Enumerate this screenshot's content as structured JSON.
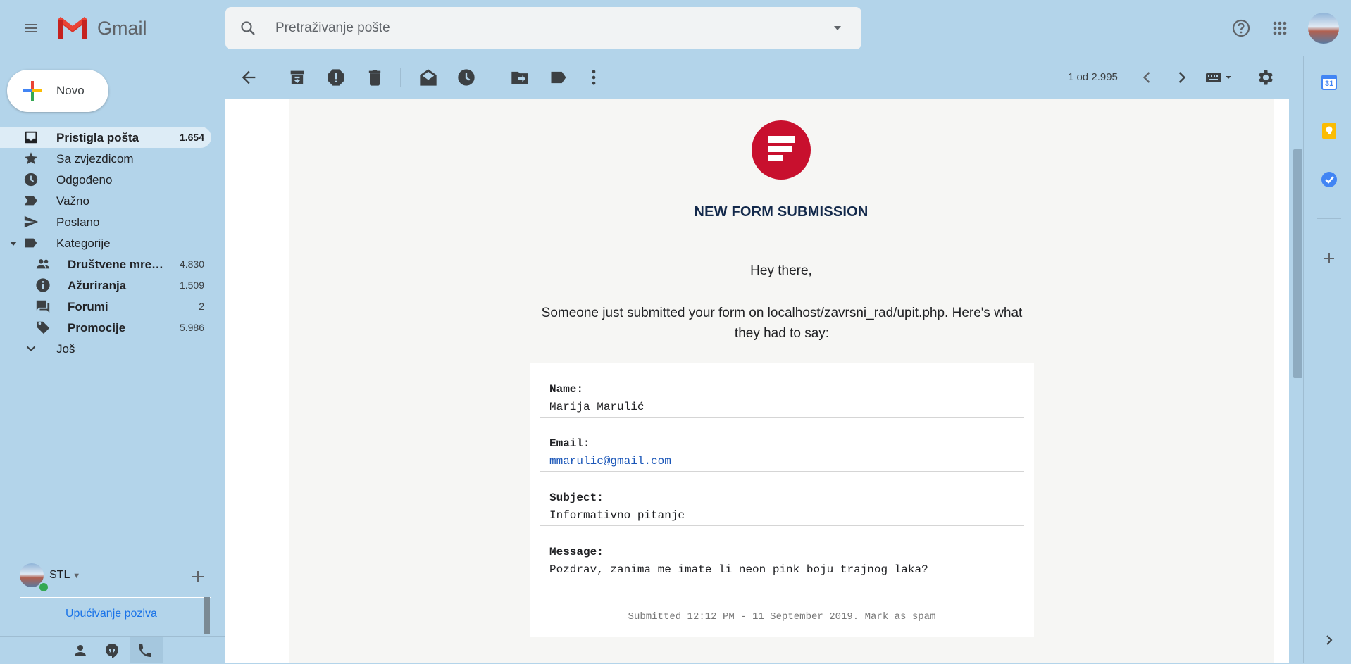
{
  "app": {
    "name": "Gmail"
  },
  "search": {
    "placeholder": "Pretraživanje pošte"
  },
  "compose": {
    "label": "Novo"
  },
  "sidebar": {
    "items": [
      {
        "label": "Pristigla pošta",
        "count": "1.654",
        "icon": "inbox-icon"
      },
      {
        "label": "Sa zvjezdicom",
        "count": "",
        "icon": "star-icon"
      },
      {
        "label": "Odgođeno",
        "count": "",
        "icon": "clock-icon"
      },
      {
        "label": "Važno",
        "count": "",
        "icon": "important-icon"
      },
      {
        "label": "Poslano",
        "count": "",
        "icon": "send-icon"
      },
      {
        "label": "Kategorije",
        "count": "",
        "icon": "label-icon"
      }
    ],
    "categories": [
      {
        "label": "Društvene mre…",
        "count": "4.830",
        "icon": "people-icon"
      },
      {
        "label": "Ažuriranja",
        "count": "1.509",
        "icon": "info-icon"
      },
      {
        "label": "Forumi",
        "count": "2",
        "icon": "forum-icon"
      },
      {
        "label": "Promocije",
        "count": "5.986",
        "icon": "tag-icon"
      }
    ],
    "more": {
      "label": "Još"
    }
  },
  "hangouts": {
    "name": "STL",
    "invite": "Upućivanje poziva"
  },
  "toolbar": {
    "page_info": "1 od 2.995"
  },
  "email": {
    "heading": "NEW FORM SUBMISSION",
    "greeting": "Hey there,",
    "intro": "Someone just submitted your form on localhost/zavrsni_rad/upit.php. Here's what they had to say:",
    "fields": [
      {
        "label": "Name:",
        "value": "Marija Marulić"
      },
      {
        "label": "Email:",
        "value": "mmarulic@gmail.com"
      },
      {
        "label": "Subject:",
        "value": "Informativno pitanje"
      },
      {
        "label": "Message:",
        "value": "Pozdrav, zanima me imate li neon pink boju trajnog laka?"
      }
    ],
    "footer": {
      "text": "Submitted 12:12 PM - 11 September 2019.",
      "spam_link": "Mark as spam"
    }
  },
  "rail": {
    "calendar_day": "31"
  },
  "colors": {
    "background": "#b3d4ea",
    "brand_red": "#c8102e",
    "link_blue": "#1a73e8"
  }
}
